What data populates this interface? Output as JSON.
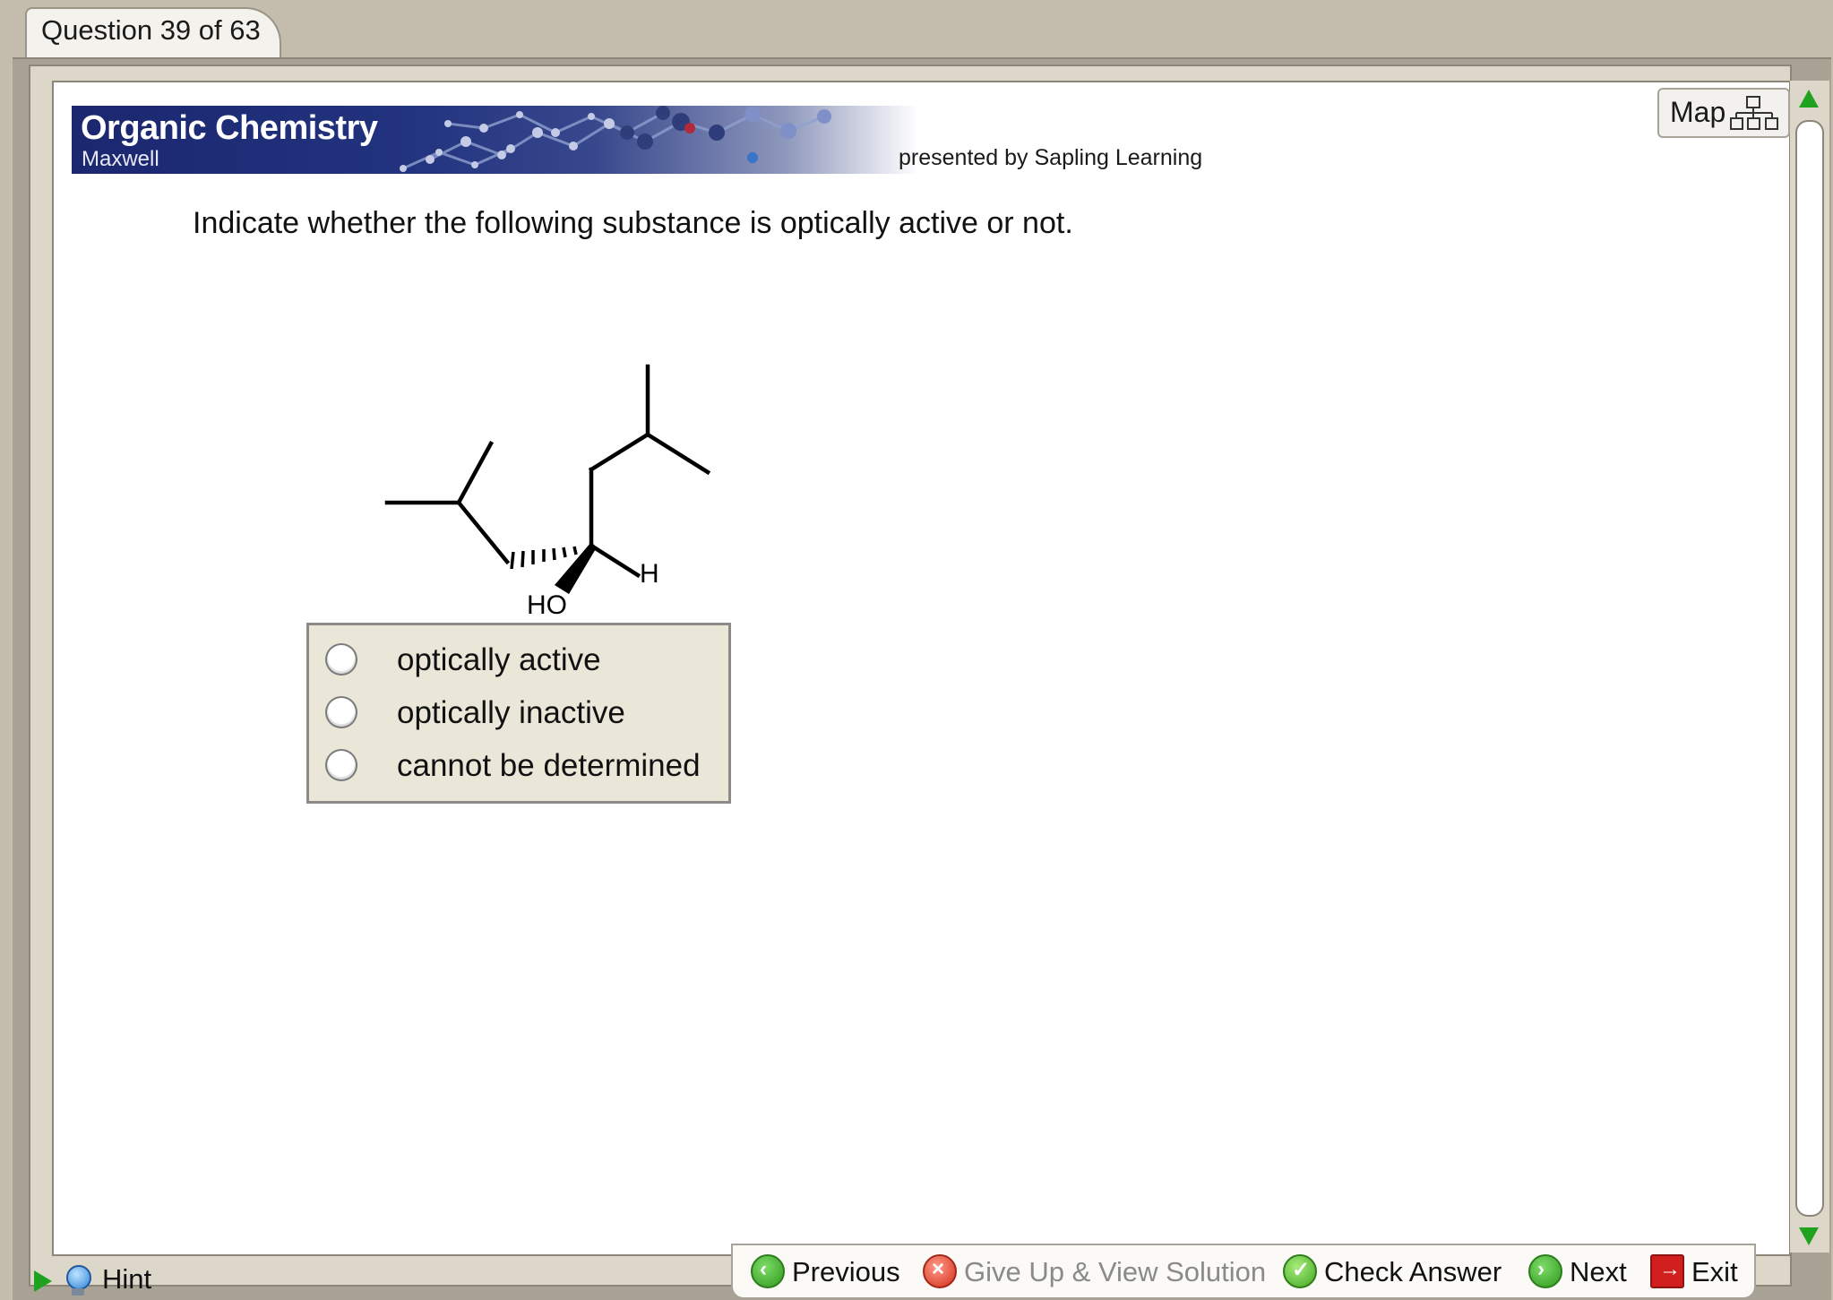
{
  "tab": {
    "label": "Question 39 of 63"
  },
  "banner": {
    "title": "Organic Chemistry",
    "subtitle": "Maxwell",
    "presented_by": "presented by Sapling Learning"
  },
  "map_button": {
    "label": "Map",
    "icon": "sitemap-icon"
  },
  "question": {
    "text": "Indicate whether the following substance is optically active or not."
  },
  "molecule": {
    "atom_labels": {
      "hydroxyl": "HO",
      "hydrogen": "H"
    }
  },
  "choices": [
    {
      "label": "optically active",
      "selected": false
    },
    {
      "label": "optically inactive",
      "selected": false
    },
    {
      "label": "cannot be determined",
      "selected": false
    }
  ],
  "nav": {
    "previous": "Previous",
    "give_up": "Give Up & View Solution",
    "check": "Check Answer",
    "next": "Next",
    "exit": "Exit"
  },
  "hint": {
    "label": "Hint"
  },
  "colors": {
    "banner_blue": "#1b276f",
    "accent_green": "#1fa21f",
    "panel_beige": "#eae6d8",
    "chrome_tan": "#c4bcad"
  }
}
